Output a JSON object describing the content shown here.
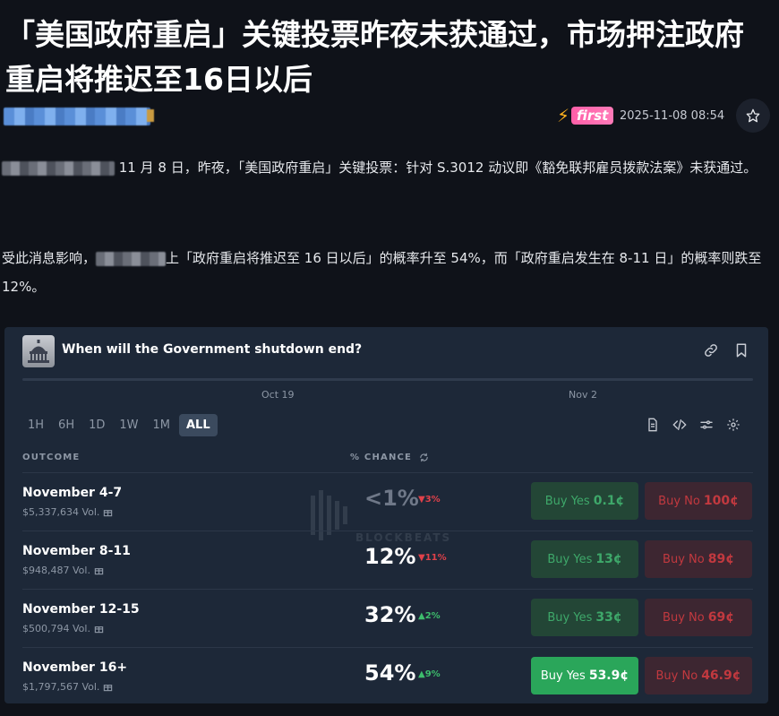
{
  "headline": "「美国政府重启」关键投票昨夜未获通过，市场押注政府重启将推迟至16日以后",
  "meta": {
    "badge": "first",
    "date": "2025-11-08 08:54"
  },
  "article": {
    "p1": " 11 月 8 日，昨夜，「美国政府重启」关键投票：针对 S.3012 动议即《豁免联邦雇员拨款法案》未获通过。",
    "p2_start": "受此消息影响，",
    "p2_end": "上「政府重启将推迟至 16 日以后」的概率升至 54%，而「政府重启发生在 8-11 日」的概率则跌至 12%。"
  },
  "embed": {
    "title": "When will the Government shutdown end?",
    "axis_dates": [
      "Oct 19",
      "Nov 2"
    ],
    "timeframes": [
      "1H",
      "6H",
      "1D",
      "1W",
      "1M",
      "ALL"
    ],
    "active_timeframe": "ALL",
    "col_outcome": "OUTCOME",
    "col_chance": "% CHANCE",
    "watermark": "BLOCKBEATS",
    "rows": [
      {
        "name": "November 4-7",
        "vol": "$5,337,634 Vol.",
        "pct": "<1%",
        "chg": "▼3%",
        "dir": "down",
        "yes_label": "Buy Yes",
        "yes_price": "0.1¢",
        "no_label": "Buy No",
        "no_price": "100¢"
      },
      {
        "name": "November 8-11",
        "vol": "$948,487 Vol.",
        "pct": "12%",
        "chg": "▼11%",
        "dir": "down",
        "yes_label": "Buy Yes",
        "yes_price": "13¢",
        "no_label": "Buy No",
        "no_price": "89¢"
      },
      {
        "name": "November 12-15",
        "vol": "$500,794 Vol.",
        "pct": "32%",
        "chg": "▲2%",
        "dir": "up",
        "yes_label": "Buy Yes",
        "yes_price": "33¢",
        "no_label": "Buy No",
        "no_price": "69¢"
      },
      {
        "name": "November 16+",
        "vol": "$1,797,567 Vol.",
        "pct": "54%",
        "chg": "▲9%",
        "dir": "up",
        "yes_label": "Buy Yes",
        "yes_price": "53.9¢",
        "no_label": "Buy No",
        "no_price": "46.9¢"
      }
    ]
  }
}
